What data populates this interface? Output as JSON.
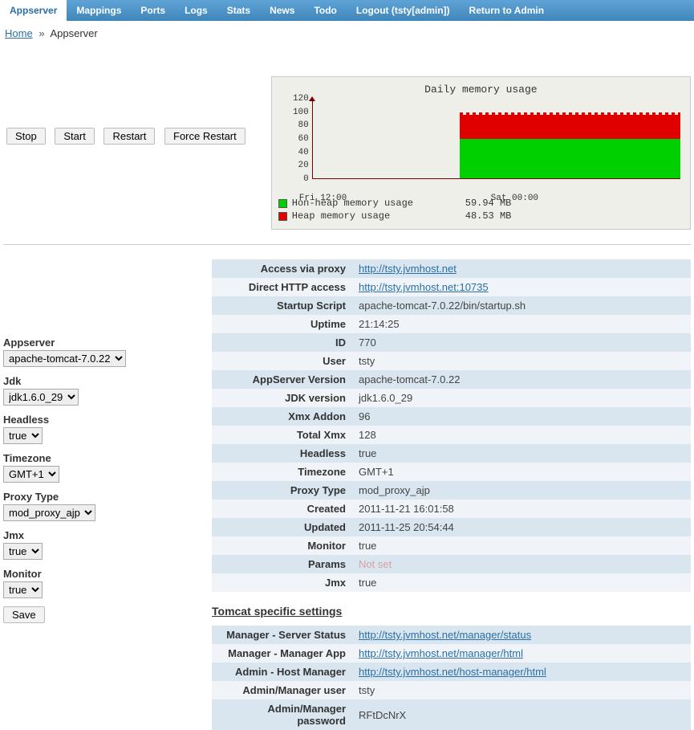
{
  "nav": {
    "tabs": [
      "Appserver",
      "Mappings",
      "Ports",
      "Logs",
      "Stats",
      "News",
      "Todo",
      "Logout (tsty[admin])",
      "Return to Admin"
    ],
    "active": 0
  },
  "breadcrumb": {
    "home": "Home",
    "sep": "»",
    "current": "Appserver"
  },
  "actions": {
    "stop": "Stop",
    "start": "Start",
    "restart": "Restart",
    "force_restart": "Force Restart"
  },
  "chart": {
    "title": "Daily memory usage",
    "yticks": [
      "120",
      "100",
      "80",
      "60",
      "40",
      "20",
      "0"
    ],
    "xticks": [
      {
        "label": "Fri 12:00",
        "pos": 3
      },
      {
        "label": "Sat 00:00",
        "pos": 55
      }
    ],
    "legend": [
      {
        "color": "#00d000",
        "label": "Hon-heap memory usage",
        "value": "59.94 MB"
      },
      {
        "color": "#e00000",
        "label": "Heap memory usage",
        "value": "48.53 MB"
      }
    ]
  },
  "chart_data": {
    "type": "area",
    "title": "Daily memory usage",
    "xlabel": "",
    "ylabel": "",
    "ylim": [
      0,
      120
    ],
    "x_range": [
      "Fri 12:00",
      "Sat 12:00"
    ],
    "series": [
      {
        "name": "Hon-heap memory usage",
        "value_mb": 59.94,
        "approx_segments": [
          {
            "from_pct": 40,
            "to_pct": 100,
            "level": 60
          }
        ]
      },
      {
        "name": "Heap memory usage",
        "value_mb": 48.53,
        "approx_segments": [
          {
            "from_pct": 40,
            "to_pct": 100,
            "low": 90,
            "high": 108
          }
        ]
      }
    ],
    "note": "Both series are zero before ~Fri 22:00 (≈40% across), then non-heap holds ~60 and heap oscillates ~90–108 in a sawtooth."
  },
  "form": {
    "appserver": {
      "label": "Appserver",
      "value": "apache-tomcat-7.0.22"
    },
    "jdk": {
      "label": "Jdk",
      "value": "jdk1.6.0_29"
    },
    "headless": {
      "label": "Headless",
      "value": "true"
    },
    "timezone": {
      "label": "Timezone",
      "value": "GMT+1"
    },
    "proxy_type": {
      "label": "Proxy Type",
      "value": "mod_proxy_ajp"
    },
    "jmx": {
      "label": "Jmx",
      "value": "true"
    },
    "monitor": {
      "label": "Monitor",
      "value": "true"
    },
    "save": "Save"
  },
  "info": [
    {
      "k": "Access via proxy",
      "v": "http://tsty.jvmhost.net",
      "link": true
    },
    {
      "k": "Direct HTTP access",
      "v": "http://tsty.jvmhost.net:10735",
      "link": true
    },
    {
      "k": "Startup Script",
      "v": "apache-tomcat-7.0.22/bin/startup.sh"
    },
    {
      "k": "Uptime",
      "v": "21:14:25"
    },
    {
      "k": "ID",
      "v": "770"
    },
    {
      "k": "User",
      "v": "tsty"
    },
    {
      "k": "AppServer Version",
      "v": "apache-tomcat-7.0.22"
    },
    {
      "k": "JDK version",
      "v": "jdk1.6.0_29"
    },
    {
      "k": "Xmx Addon",
      "v": "96"
    },
    {
      "k": "Total Xmx",
      "v": "128"
    },
    {
      "k": "Headless",
      "v": "true"
    },
    {
      "k": "Timezone",
      "v": "GMT+1"
    },
    {
      "k": "Proxy Type",
      "v": "mod_proxy_ajp"
    },
    {
      "k": "Created",
      "v": "2011-11-21 16:01:58"
    },
    {
      "k": "Updated",
      "v": "2011-11-25 20:54:44"
    },
    {
      "k": "Monitor",
      "v": "true"
    },
    {
      "k": "Params",
      "v": "Not set",
      "notset": true
    },
    {
      "k": "Jmx",
      "v": "true"
    }
  ],
  "tomcat_heading": "Tomcat specific settings",
  "tomcat": [
    {
      "k": "Manager - Server Status",
      "v": "http://tsty.jvmhost.net/manager/status",
      "link": true
    },
    {
      "k": "Manager - Manager App",
      "v": "http://tsty.jvmhost.net/manager/html",
      "link": true
    },
    {
      "k": "Admin - Host Manager",
      "v": "http://tsty.jvmhost.net/host-manager/html",
      "link": true
    },
    {
      "k": "Admin/Manager user",
      "v": "tsty"
    },
    {
      "k": "Admin/Manager password",
      "v": "RFtDcNrX"
    }
  ]
}
